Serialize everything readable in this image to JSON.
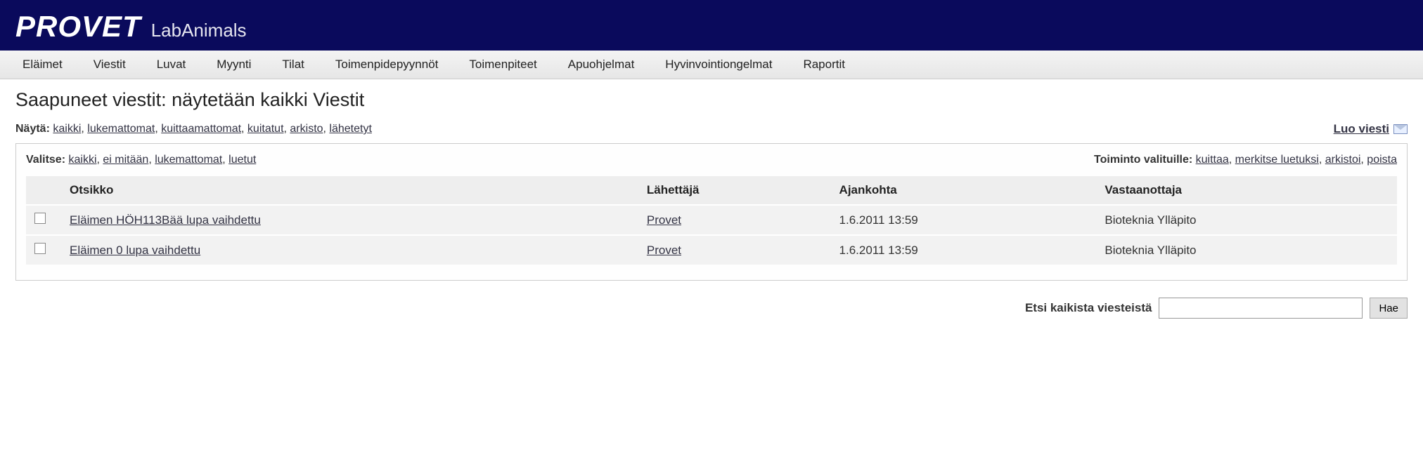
{
  "header": {
    "logo": "PROVET",
    "subtitle": "LabAnimals"
  },
  "nav": [
    "Eläimet",
    "Viestit",
    "Luvat",
    "Myynti",
    "Tilat",
    "Toimenpidepyynnöt",
    "Toimenpiteet",
    "Apuohjelmat",
    "Hyvinvointiongelmat",
    "Raportit"
  ],
  "page_title": "Saapuneet viestit: näytetään kaikki Viestit",
  "show_label": "Näytä:",
  "show_filters": [
    "kaikki",
    "lukemattomat",
    "kuittaamattomat",
    "kuitatut",
    "arkisto",
    "lähetetyt"
  ],
  "create_label": "Luo viesti",
  "select_label": "Valitse:",
  "select_options": [
    "kaikki",
    "ei mitään",
    "lukemattomat",
    "luetut"
  ],
  "action_label": "Toiminto valituille:",
  "actions": [
    "kuittaa",
    "merkitse luetuksi",
    "arkistoi",
    "poista"
  ],
  "columns": {
    "title": "Otsikko",
    "sender": "Lähettäjä",
    "time": "Ajankohta",
    "recipient": "Vastaanottaja"
  },
  "rows": [
    {
      "title": "Eläimen HÖH113Bää lupa vaihdettu",
      "sender": "Provet",
      "time": "1.6.2011 13:59",
      "recipient": "Bioteknia Ylläpito"
    },
    {
      "title": "Eläimen 0 lupa vaihdettu",
      "sender": "Provet",
      "time": "1.6.2011 13:59",
      "recipient": "Bioteknia Ylläpito"
    }
  ],
  "search": {
    "label": "Etsi kaikista viesteistä",
    "button": "Hae",
    "value": ""
  }
}
